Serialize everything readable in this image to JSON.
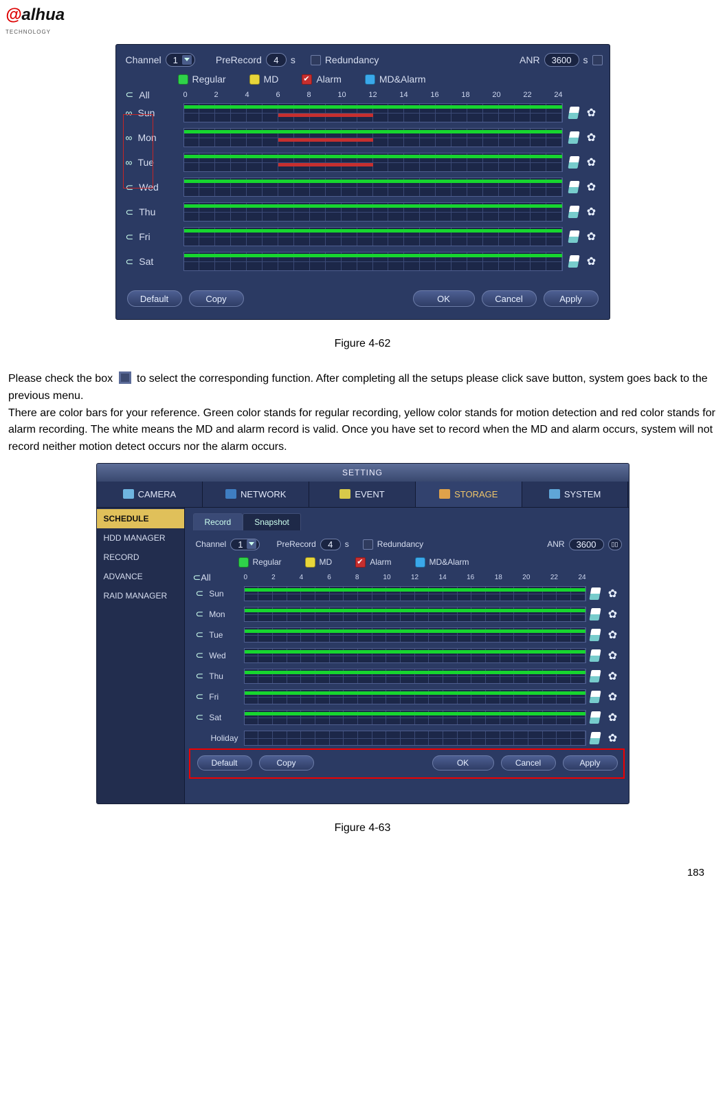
{
  "logo": {
    "text": "alhua",
    "sub": "TECHNOLOGY"
  },
  "page_number": "183",
  "paragraph": {
    "p1a": "Please check the box ",
    "p1b": " to select the corresponding function. After completing all the setups please click save button, system goes back to the previous menu.",
    "p2": "There are color bars for your reference. Green color stands for regular recording, yellow color stands for motion detection and red color stands for alarm recording. The white means the MD and alarm record is valid. Once you have set to record when the MD and alarm occurs, system will not record neither motion detect occurs nor the alarm occurs."
  },
  "fig1": {
    "caption": "Figure 4-62",
    "top": {
      "channel_label": "Channel",
      "channel_value": "1",
      "prerecord_label": "PreRecord",
      "prerecord_value": "4",
      "prerecord_unit": "s",
      "redundancy_label": "Redundancy",
      "anr_label": "ANR",
      "anr_value": "3600",
      "anr_unit": "s"
    },
    "legend": {
      "regular": "Regular",
      "md": "MD",
      "alarm": "Alarm",
      "mdalarm": "MD&Alarm"
    },
    "all_label": "All",
    "hours": [
      "0",
      "2",
      "4",
      "6",
      "8",
      "10",
      "12",
      "14",
      "16",
      "18",
      "20",
      "22",
      "24"
    ],
    "days": [
      "Sun",
      "Mon",
      "Tue",
      "Wed",
      "Thu",
      "Fri",
      "Sat"
    ],
    "buttons": {
      "default": "Default",
      "copy": "Copy",
      "ok": "OK",
      "cancel": "Cancel",
      "apply": "Apply"
    }
  },
  "fig2": {
    "caption": "Figure 4-63",
    "title": "SETTING",
    "maintabs": {
      "camera": "CAMERA",
      "network": "NETWORK",
      "event": "EVENT",
      "storage": "STORAGE",
      "system": "SYSTEM"
    },
    "sidebar": [
      "SCHEDULE",
      "HDD MANAGER",
      "RECORD",
      "ADVANCE",
      "RAID MANAGER"
    ],
    "subtabs": {
      "record": "Record",
      "snapshot": "Snapshot"
    },
    "top": {
      "channel_label": "Channel",
      "channel_value": "1",
      "prerecord_label": "PreRecord",
      "prerecord_value": "4",
      "prerecord_unit": "s",
      "redundancy_label": "Redundancy",
      "anr_label": "ANR",
      "anr_value": "3600"
    },
    "legend": {
      "regular": "Regular",
      "md": "MD",
      "alarm": "Alarm",
      "mdalarm": "MD&Alarm"
    },
    "all_label": "All",
    "hours": [
      "0",
      "2",
      "4",
      "6",
      "8",
      "10",
      "12",
      "14",
      "16",
      "18",
      "20",
      "22",
      "24"
    ],
    "days": [
      "Sun",
      "Mon",
      "Tue",
      "Wed",
      "Thu",
      "Fri",
      "Sat",
      "Holiday"
    ],
    "buttons": {
      "default": "Default",
      "copy": "Copy",
      "ok": "OK",
      "cancel": "Cancel",
      "apply": "Apply"
    }
  }
}
